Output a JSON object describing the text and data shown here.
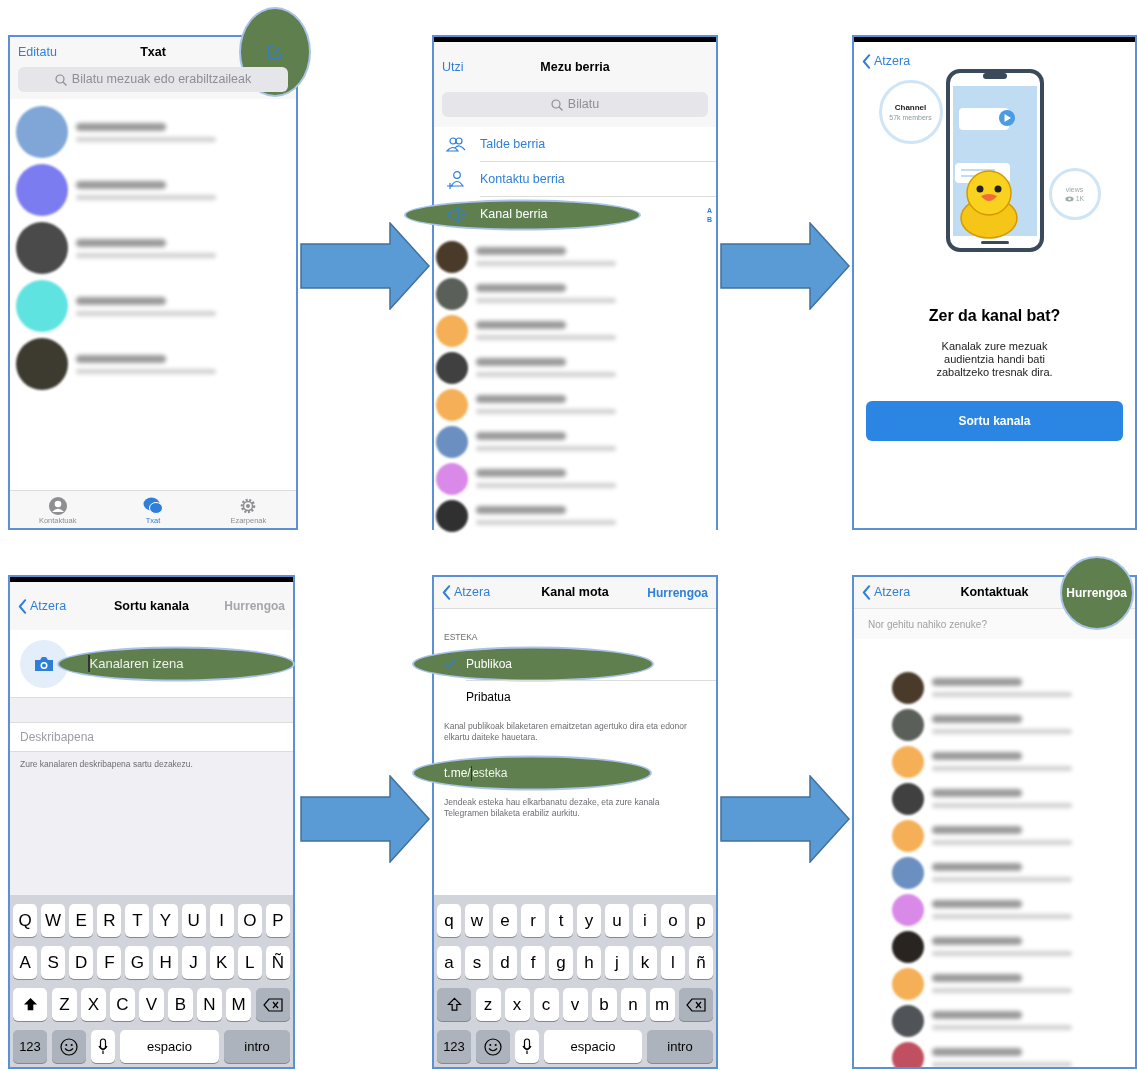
{
  "panels": [
    {
      "kind": "chats",
      "nav": {
        "left": "Editatu",
        "title": "Txat",
        "compose_highlighted": true
      },
      "search": {
        "placeholder": "Bilatu mezuak edo erabiltzaileak"
      },
      "blurred_rows": [
        {
          "color": "#7fa6d6"
        },
        {
          "color": "#7b7cf0"
        },
        {
          "color": "#4a4a4a"
        },
        {
          "color": "#5fe3e0"
        },
        {
          "color": "#3d3a30"
        }
      ],
      "tabs": [
        {
          "label": "Kontaktuak",
          "selected": false,
          "kind": "person"
        },
        {
          "label": "Txat",
          "selected": true,
          "kind": "chat"
        },
        {
          "label": "Ezarpenak",
          "selected": false,
          "kind": "gear"
        }
      ]
    },
    {
      "kind": "new_message",
      "nav": {
        "left": "Utzi",
        "title": "Mezu berria"
      },
      "search": {
        "placeholder": "Bilatu"
      },
      "actions": [
        {
          "label": "Talde berria",
          "kind": "group",
          "highlighted": false
        },
        {
          "label": "Kontaktu berria",
          "kind": "add_contact",
          "highlighted": false
        },
        {
          "label": "Kanal berria",
          "kind": "megaphone",
          "highlighted": true
        }
      ],
      "index_letters": [
        "A",
        "B"
      ],
      "blurred_rows": [
        {
          "color": "#4a3a2a"
        },
        {
          "color": "#5a5f5a"
        },
        {
          "color": "#f5b057"
        },
        {
          "color": "#404040"
        },
        {
          "color": "#f5b057"
        },
        {
          "color": "#6b8fc0"
        },
        {
          "color": "#d98ae8"
        },
        {
          "color": "#303030"
        }
      ]
    },
    {
      "kind": "channel_intro",
      "nav": {
        "back": "Atzera"
      },
      "illustration": {
        "channel": "Channel",
        "members": "57k members",
        "views": "views",
        "count": "1K"
      },
      "heading": "Zer da kanal bat?",
      "body": "Kanalak zure mezuak audientzia handi bati zabaltzeko tresnak dira.",
      "button": "Sortu kanala"
    },
    {
      "kind": "create_channel",
      "nav": {
        "back": "Atzera",
        "title": "Sortu kanala",
        "next": "Hurrengoa",
        "next_disabled": true
      },
      "name_field": {
        "placeholder": "Kanalaren izena",
        "highlighted": true
      },
      "description_field": {
        "placeholder": "Deskribapena"
      },
      "hint": "Zure kanalaren deskribapena sartu dezakezu.",
      "keyboard": {
        "shift_on": true,
        "rows": [
          [
            "Q",
            "W",
            "E",
            "R",
            "T",
            "Y",
            "U",
            "I",
            "O",
            "P"
          ],
          [
            "A",
            "S",
            "D",
            "F",
            "G",
            "H",
            "J",
            "K",
            "L",
            "Ñ"
          ],
          [
            "Z",
            "X",
            "C",
            "V",
            "B",
            "N",
            "M"
          ]
        ],
        "numbers_key": "123",
        "space_key": "espacio",
        "return_key": "intro"
      }
    },
    {
      "kind": "channel_type",
      "nav": {
        "back": "Atzera",
        "title": "Kanal mota",
        "next": "Hurrengoa",
        "next_disabled": false
      },
      "section": "ESTEKA",
      "options": [
        {
          "label": "Publikoa",
          "checked": true,
          "highlighted": true
        },
        {
          "label": "Pribatua",
          "checked": false,
          "highlighted": false
        }
      ],
      "hint": "Kanal publikoak bilaketaren emaitzetan agertuko dira eta edonor elkartu daiteke hauetara.",
      "link_field": {
        "prefix": "t.me/",
        "placeholder": "esteka",
        "highlighted": true
      },
      "link_hint": "Jendeak esteka hau elkarbanatu dezake, eta zure kanala Telegramen bilaketa erabiliz aurkitu.",
      "keyboard": {
        "shift_on": false,
        "rows": [
          [
            "q",
            "w",
            "e",
            "r",
            "t",
            "y",
            "u",
            "i",
            "o",
            "p"
          ],
          [
            "a",
            "s",
            "d",
            "f",
            "g",
            "h",
            "j",
            "k",
            "l",
            "ñ"
          ],
          [
            "z",
            "x",
            "c",
            "v",
            "b",
            "n",
            "m"
          ]
        ],
        "numbers_key": "123",
        "space_key": "espacio",
        "return_key": "intro"
      }
    },
    {
      "kind": "contacts",
      "nav": {
        "back": "Atzera",
        "title": "Kontaktuak",
        "next": "Hurrengoa",
        "next_disabled": false,
        "next_highlighted": true
      },
      "search": {
        "placeholder": "Nor gehitu nahiko zenuke?"
      },
      "blurred_rows": [
        {
          "color": "#4a3a2a"
        },
        {
          "color": "#5a5f5a"
        },
        {
          "color": "#f5b057"
        },
        {
          "color": "#404040"
        },
        {
          "color": "#f5b057"
        },
        {
          "color": "#6b8fc0"
        },
        {
          "color": "#d98ae8"
        },
        {
          "color": "#2a2420"
        },
        {
          "color": "#f5b057"
        },
        {
          "color": "#505458"
        },
        {
          "color": "#c05060"
        }
      ]
    }
  ]
}
